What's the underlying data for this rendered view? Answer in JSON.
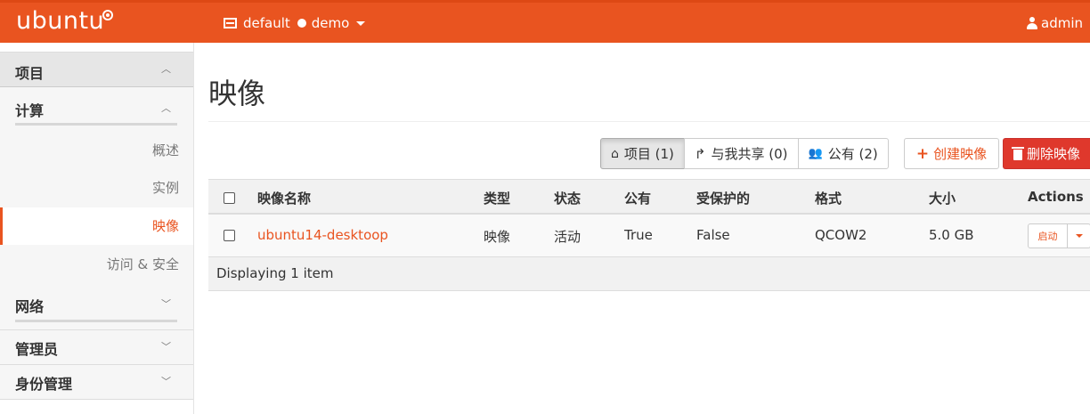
{
  "brand": {
    "name": "ubuntu"
  },
  "topbar": {
    "domain": "default",
    "project": "demo",
    "user": "admin"
  },
  "sidebar": {
    "project": "项目",
    "compute": "计算",
    "items": [
      {
        "label": "概述"
      },
      {
        "label": "实例"
      },
      {
        "label": "映像"
      },
      {
        "label": "访问 & 安全"
      }
    ],
    "network": "网络",
    "admin": "管理员",
    "identity": "身份管理"
  },
  "page": {
    "title": "映像"
  },
  "filters": [
    {
      "label": "项目 (1)",
      "icon": "home-icon"
    },
    {
      "label": "与我共享 (0)",
      "icon": "share-icon"
    },
    {
      "label": "公有 (2)",
      "icon": "users-icon"
    }
  ],
  "actions": {
    "create": "创建映像",
    "delete": "删除映像"
  },
  "table": {
    "columns": [
      "映像名称",
      "类型",
      "状态",
      "公有",
      "受保护的",
      "格式",
      "大小",
      "Actions"
    ],
    "rows": [
      {
        "name": "ubuntu14-desktoop",
        "type": "映像",
        "status": "活动",
        "public": "True",
        "protected": "False",
        "format": "QCOW2",
        "size": "5.0 GB",
        "action": "启动"
      }
    ],
    "footer": "Displaying 1 item"
  },
  "colors": {
    "accent": "#e95420",
    "danger": "#df382c"
  }
}
